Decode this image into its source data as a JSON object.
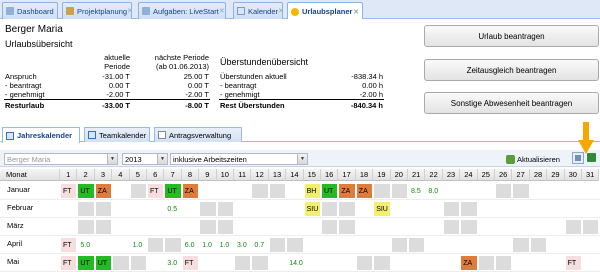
{
  "tabs": [
    {
      "label": "Dashboard",
      "active": false
    },
    {
      "label": "Projektplanung",
      "active": false
    },
    {
      "label": "Aufgaben: LiveStart",
      "active": false
    },
    {
      "label": "Kalender",
      "active": false
    },
    {
      "label": "Urlaubsplaner",
      "active": true
    }
  ],
  "user_name": "Berger Maria",
  "vacation": {
    "title": "Urlaubsübersicht",
    "col_current": "aktuelle Periode",
    "col_current_l1": "aktuelle",
    "col_current_l2": "Periode",
    "col_next_l1": "nächste Periode",
    "col_next_l2": "(ab 01.06.2013)",
    "rows": [
      {
        "label": "Anspruch",
        "current": "-31.00 T",
        "next": "25.00 T"
      },
      {
        "label": "- beantragt",
        "current": "0.00 T",
        "next": "0.00 T"
      },
      {
        "label": "- genehmigt",
        "current": "-2.00 T",
        "next": "-2.00 T"
      }
    ],
    "total_label": "Resturlaub",
    "total_current": "-33.00 T",
    "total_next": "-8.00 T"
  },
  "overtime": {
    "title": "Überstundenübersicht",
    "rows": [
      {
        "label": "Überstunden aktuell",
        "value": "-838.34 h"
      },
      {
        "label": "- beantragt",
        "value": "0.00 h"
      },
      {
        "label": "- genehmigt",
        "value": "-2.00 h"
      }
    ],
    "total_label": "Rest Überstunden",
    "total_value": "-840.34 h"
  },
  "buttons": {
    "vacation": "Urlaub beantragen",
    "timecomp": "Zeitausgleich beantragen",
    "other": "Sonstige Abwesenheit beantragen"
  },
  "subtabs": [
    {
      "label": "Jahreskalender",
      "active": true
    },
    {
      "label": "Teamkalender",
      "active": false
    },
    {
      "label": "Antragsverwaltung",
      "active": false
    }
  ],
  "toolbar": {
    "employee": "Berger Maria",
    "year": "2013",
    "mode": "inklusive Arbeitszeiten",
    "refresh": "Aktualisieren"
  },
  "calendar": {
    "month_header": "Monat",
    "days": [
      "1",
      "2",
      "3",
      "4",
      "5",
      "6",
      "7",
      "8",
      "9",
      "10",
      "11",
      "12",
      "13",
      "14",
      "15",
      "16",
      "17",
      "18",
      "19",
      "20",
      "21",
      "22",
      "23",
      "24",
      "25",
      "26",
      "27",
      "28",
      "29",
      "30",
      "31"
    ],
    "months": [
      {
        "name": "Januar",
        "cells": [
          {
            "day": 1,
            "text": "FT",
            "type": "ft"
          },
          {
            "day": 2,
            "text": "UT",
            "type": "ut"
          },
          {
            "day": 3,
            "text": "ZA",
            "type": "za"
          },
          {
            "day": 6,
            "text": "FT",
            "type": "ft"
          },
          {
            "day": 7,
            "text": "UT",
            "type": "ut"
          },
          {
            "day": 8,
            "text": "ZA",
            "type": "za"
          },
          {
            "day": 15,
            "text": "BH",
            "type": "bh"
          },
          {
            "day": 16,
            "text": "UT",
            "type": "ut"
          },
          {
            "day": 17,
            "text": "ZA",
            "type": "za"
          },
          {
            "day": 18,
            "text": "ZA",
            "type": "za"
          },
          {
            "day": 21,
            "text": "8.5",
            "type": "num"
          },
          {
            "day": 22,
            "text": "8.0",
            "type": "num"
          }
        ]
      },
      {
        "name": "Februar",
        "cells": [
          {
            "day": 7,
            "text": "0.5",
            "type": "num"
          },
          {
            "day": 15,
            "text": "SIU",
            "type": "siu"
          },
          {
            "day": 19,
            "text": "SIU",
            "type": "siu"
          }
        ]
      },
      {
        "name": "März",
        "cells": []
      },
      {
        "name": "April",
        "cells": [
          {
            "day": 1,
            "text": "FT",
            "type": "ft"
          },
          {
            "day": 2,
            "text": "5.0",
            "type": "num"
          },
          {
            "day": 5,
            "text": "1.0",
            "type": "num"
          },
          {
            "day": 8,
            "text": "6.0",
            "type": "num"
          },
          {
            "day": 9,
            "text": "1.0",
            "type": "num"
          },
          {
            "day": 10,
            "text": "1.0",
            "type": "num"
          },
          {
            "day": 11,
            "text": "3.0",
            "type": "num"
          },
          {
            "day": 12,
            "text": "0.7",
            "type": "num"
          }
        ]
      },
      {
        "name": "Mai",
        "cells": [
          {
            "day": 1,
            "text": "FT",
            "type": "ft"
          },
          {
            "day": 2,
            "text": "UT",
            "type": "ut"
          },
          {
            "day": 3,
            "text": "UT",
            "type": "ut"
          },
          {
            "day": 7,
            "text": "3.0",
            "type": "num"
          },
          {
            "day": 8,
            "text": "FT",
            "type": "ft"
          },
          {
            "day": 14,
            "text": "14.0",
            "type": "num"
          },
          {
            "day": 24,
            "text": "ZA",
            "type": "za"
          },
          {
            "day": 30,
            "text": "FT",
            "type": "ft"
          }
        ]
      }
    ]
  },
  "colors": {
    "ut": "#22bb22",
    "za": "#e07b39",
    "bh": "#f2ee6e",
    "siu": "#f2ee6e",
    "ft": "#f7dede",
    "weekend": "#dcdcdc",
    "num": "#118811",
    "accent_arrow": "#f5a800"
  }
}
